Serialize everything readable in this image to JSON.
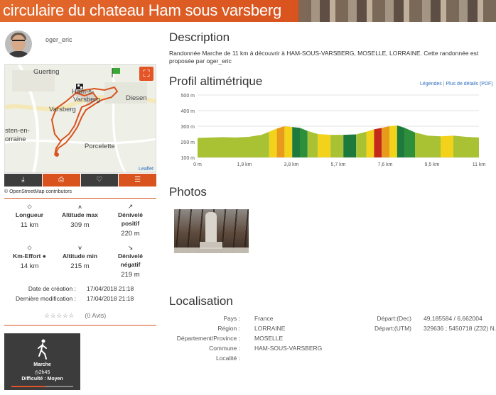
{
  "banner": {
    "title": "circulaire du chateau Ham sous varsberg"
  },
  "author": {
    "username": "oger_eric"
  },
  "map": {
    "labels": {
      "guerting": "Guerting",
      "ham": "Ham-s-",
      "varsberg_town": "Varsberg",
      "varsberg": "Varsberg",
      "diesen": "Diesen",
      "porcelette": "Porcelette",
      "sten": "sten-en-",
      "orraine": "orraine"
    },
    "attribution": "Leaflet",
    "osm_credit_prefix": "© ",
    "osm_credit": "OpenStreetMap contributors",
    "fullscreen_icon": "expand-icon",
    "actions": [
      {
        "icon": "download-icon",
        "glyph": "⤓"
      },
      {
        "icon": "print-icon",
        "glyph": "⎙"
      },
      {
        "icon": "heart-icon",
        "glyph": "♡"
      },
      {
        "icon": "list-icon",
        "glyph": "☰"
      }
    ]
  },
  "stats": {
    "longueur": {
      "label": "Longueur",
      "value": "11 km"
    },
    "alt_max": {
      "label": "Altitude max",
      "value": "309 m"
    },
    "deniv_pos": {
      "label1": "Dénivelé",
      "label2": "positif",
      "value": "220 m"
    },
    "km_effort": {
      "label": "Km-Effort",
      "value": "14 km"
    },
    "alt_min": {
      "label": "Altitude min",
      "value": "215 m"
    },
    "deniv_neg": {
      "label1": "Dénivelé",
      "label2": "négatif",
      "value": "219 m"
    }
  },
  "dates": {
    "creation_label": "Date de création :",
    "creation_value": "17/04/2018 21:18",
    "modif_label": "Dernière modification :",
    "modif_value": "17/04/2018 21:18",
    "colon": ":"
  },
  "rating": {
    "stars": "☆☆☆☆☆",
    "count": "(0 Avis)"
  },
  "activity": {
    "name": "Marche",
    "time": "2h45",
    "difficulty": "Difficulté : Moyen",
    "difficulty_level": 0.55
  },
  "description": {
    "heading": "Description",
    "text": "Randonnée Marche de 11 km à découvrir à HAM-SOUS-VARSBERG, MOSELLE, LORRAINE. Cette randonnée est proposée par oger_eric"
  },
  "profile": {
    "heading": "Profil altimétrique",
    "legend_link": "Légendes",
    "separator": "|",
    "pdf_link": "Plus de détails (PDF)"
  },
  "chart_data": {
    "type": "area",
    "title": "Profil altimétrique",
    "xlabel": "",
    "ylabel": "",
    "xlim": [
      0,
      11
    ],
    "ylim": [
      100,
      500
    ],
    "x_ticks": [
      "0 m",
      "1,9 km",
      "3,8 km",
      "5,7 km",
      "7,6 km",
      "9,5 km",
      "11 km"
    ],
    "y_ticks": [
      "500 m",
      "400 m",
      "300 m",
      "200 m",
      "100 m"
    ],
    "x": [
      0,
      0.5,
      1.0,
      1.5,
      2.0,
      2.5,
      2.8,
      3.1,
      3.4,
      3.7,
      4.0,
      4.3,
      4.7,
      5.2,
      5.7,
      6.2,
      6.6,
      6.9,
      7.2,
      7.5,
      7.8,
      8.1,
      8.5,
      9.0,
      9.5,
      10.0,
      10.5,
      11.0
    ],
    "y": [
      225,
      228,
      230,
      228,
      232,
      245,
      265,
      285,
      300,
      295,
      290,
      270,
      250,
      245,
      245,
      248,
      265,
      280,
      290,
      300,
      305,
      290,
      260,
      240,
      235,
      240,
      232,
      228
    ],
    "fill_colors": [
      "#a8c234",
      "#a8c234",
      "#a8c234",
      "#a8c234",
      "#a8c234",
      "#a8c234",
      "#f2d21b",
      "#e89a1c",
      "#f2d21b",
      "#1e7a3c",
      "#2e8f3a",
      "#a8c234",
      "#f2d21b",
      "#a8c234",
      "#1e7a3c",
      "#a8c234",
      "#f2d21b",
      "#c42a1a",
      "#e89a1c",
      "#f2d21b",
      "#1e7a3c",
      "#2e8f3a",
      "#a8c234",
      "#a8c234",
      "#f2d21b",
      "#a8c234",
      "#a8c234"
    ],
    "grid": true
  },
  "photos": {
    "heading": "Photos"
  },
  "localisation": {
    "heading": "Localisation",
    "rows": [
      {
        "label": "Pays :",
        "value": "France"
      },
      {
        "label": "Région :",
        "value": "LORRAINE"
      },
      {
        "label": "Département/Province :",
        "value": "MOSELLE"
      },
      {
        "label": "Commune :",
        "value": "HAM-SOUS-VARSBERG"
      },
      {
        "label": "Localité :",
        "value": ""
      }
    ],
    "depart_dec_label": "Départ:(Dec)",
    "depart_dec_value": "49,185584 / 6,662004",
    "depart_utm_label": "Départ:(UTM)",
    "depart_utm_value": "329636 ; 5450718 (Z32) N."
  }
}
